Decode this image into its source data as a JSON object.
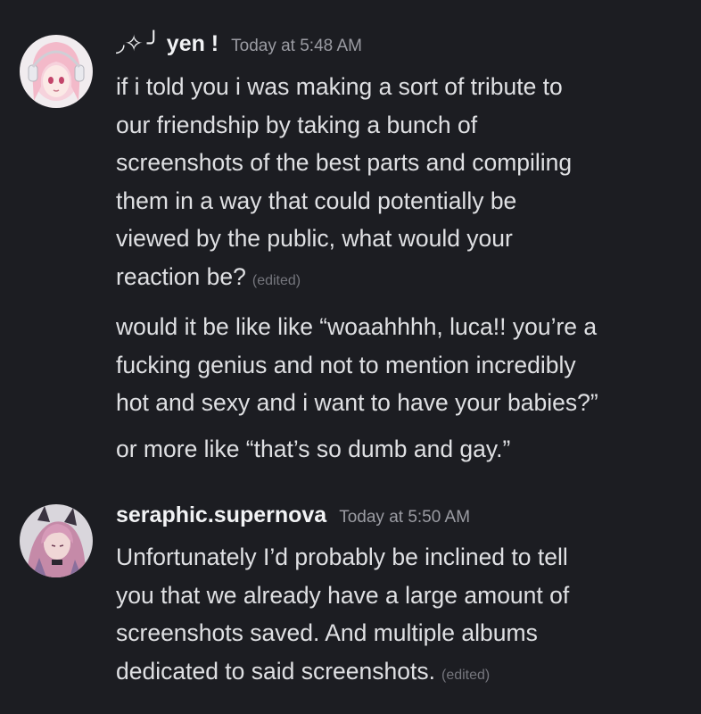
{
  "messages": [
    {
      "username": "◞✧ ╯ yen !",
      "timestamp": "Today at 5:48 AM",
      "avatar_icon": "anime-girl-headphones-avatar",
      "paragraphs": [
        {
          "lines": [
            "if i told you i was making a sort of tribute to",
            "our friendship by taking a bunch of",
            "screenshots of the best parts and compiling",
            "them in a way that could potentially be",
            "viewed by the public, what would your",
            "reaction be?"
          ],
          "edited": "(edited)"
        },
        {
          "lines": [
            "would it be like like “woaahhhh, luca!! you’re a",
            "fucking genius and not to mention incredibly",
            "hot and sexy and i want to have your babies?”"
          ]
        },
        {
          "lines": [
            "or more like “that’s so dumb and gay.”"
          ]
        }
      ]
    },
    {
      "username": "seraphic.supernova",
      "timestamp": "Today at 5:50 AM",
      "avatar_icon": "pink-hair-character-avatar",
      "paragraphs": [
        {
          "lines": [
            "Unfortunately I’d probably be inclined to tell",
            "you that we already have a large amount of",
            "screenshots saved. And multiple albums",
            "dedicated to said screenshots."
          ],
          "edited": "(edited)"
        }
      ]
    }
  ],
  "colors": {
    "background": "#1c1d22",
    "username": "#f2f3f5",
    "message_text": "#dfe0e3",
    "timestamp": "#9b9ca3",
    "edited": "#75767d"
  }
}
